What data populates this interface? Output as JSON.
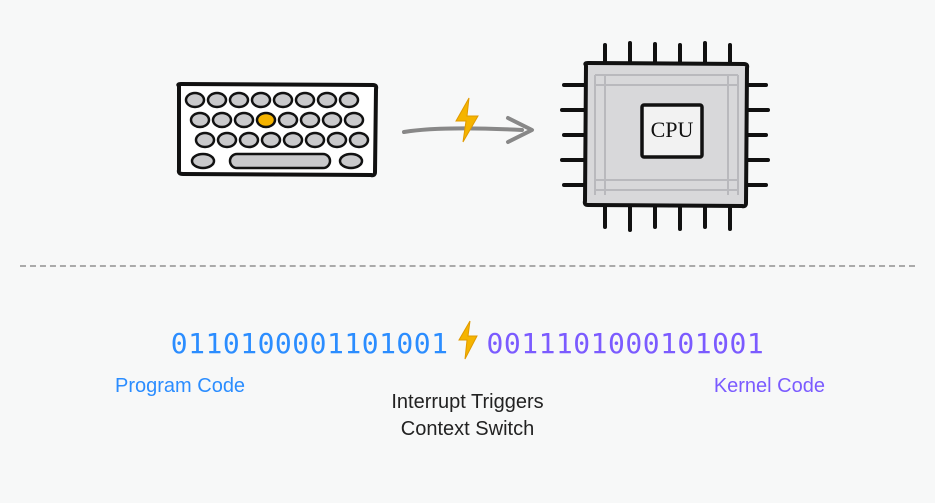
{
  "top": {
    "keyboard_icon": "keyboard",
    "arrow_icon": "arrow-right",
    "lightning_icon": "lightning-bolt",
    "cpu_label": "CPU"
  },
  "binary": {
    "program": "0110100001101001",
    "kernel": "0011101000101001"
  },
  "labels": {
    "program": "Program Code",
    "kernel": "Kernel Code",
    "interrupt_line1": "Interrupt Triggers",
    "interrupt_line2": "Context Switch"
  },
  "colors": {
    "program": "#2b8dff",
    "kernel": "#7b5bff",
    "bolt": "#f5b400",
    "stroke": "#111"
  }
}
